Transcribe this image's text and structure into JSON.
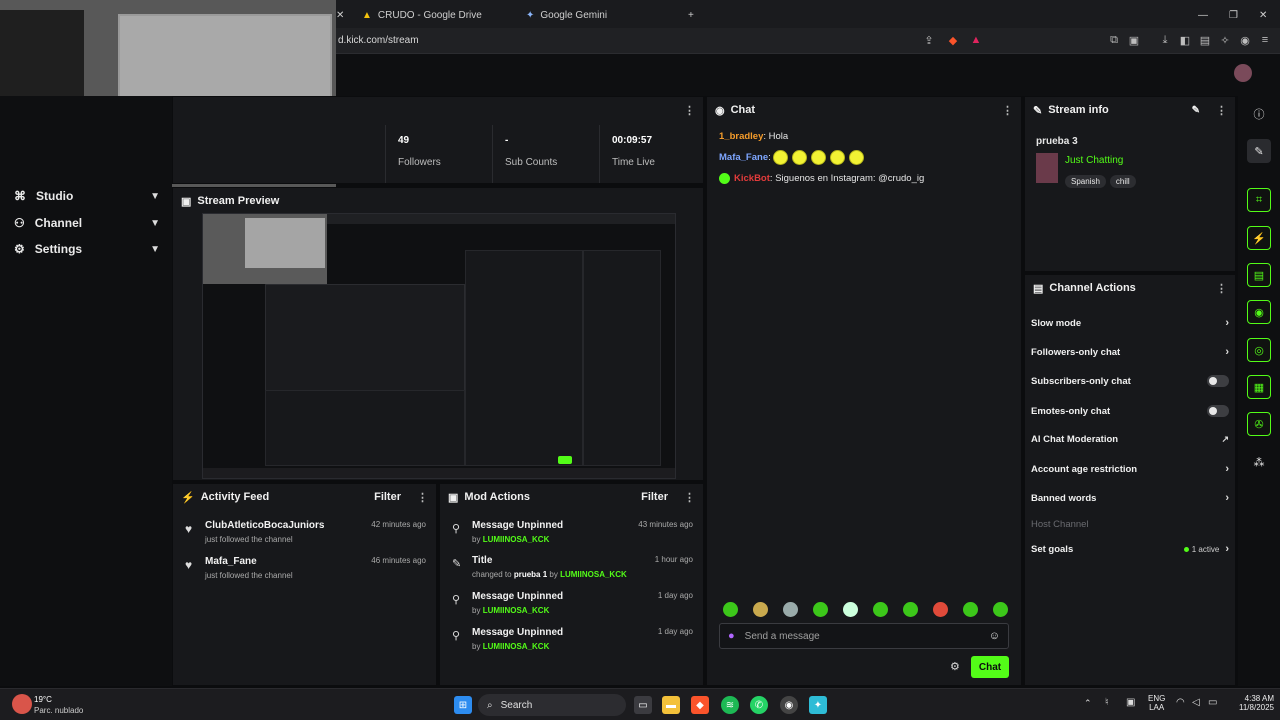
{
  "browser": {
    "tabs": [
      {
        "label": "CRUDO - Google Drive"
      },
      {
        "label": "Google Gemini"
      }
    ],
    "url": "d.kick.com/stream"
  },
  "sidebar": {
    "items": [
      {
        "label": "Studio"
      },
      {
        "label": "Channel"
      },
      {
        "label": "Settings"
      }
    ]
  },
  "stats": [
    {
      "value": "49",
      "label": "Followers"
    },
    {
      "value": "-",
      "label": "Sub Counts"
    },
    {
      "value": "00:09:57",
      "label": "Time Live"
    }
  ],
  "preview": {
    "title": "Stream Preview"
  },
  "activity": {
    "title": "Activity Feed",
    "filter": "Filter",
    "items": [
      {
        "name": "ClubAtleticoBocaJuniors",
        "sub": "just followed the channel",
        "time": "42 minutes ago"
      },
      {
        "name": "Mafa_Fane",
        "sub": "just followed the channel",
        "time": "46 minutes ago"
      }
    ]
  },
  "mod": {
    "title": "Mod Actions",
    "filter": "Filter",
    "items": [
      {
        "title": "Message Unpinned",
        "by": "by",
        "user": "LUMIINOSA_KCK",
        "mid": "",
        "time": "43 minutes ago"
      },
      {
        "title": "Title",
        "by": "changed to",
        "mid": "prueba 1",
        "by2": "by",
        "user": "LUMIINOSA_KCK",
        "time": "1 hour ago"
      },
      {
        "title": "Message Unpinned",
        "by": "by",
        "user": "LUMIINOSA_KCK",
        "mid": "",
        "time": "1 day ago"
      },
      {
        "title": "Message Unpinned",
        "by": "by",
        "user": "LUMIINOSA_KCK",
        "mid": "",
        "time": "1 day ago"
      }
    ]
  },
  "chat": {
    "title": "Chat",
    "messages": [
      {
        "user": "1_bradley",
        "color": "#f59c2b",
        "text": "Hola"
      },
      {
        "user": "Mafa_Fane",
        "color": "#7ea6ff",
        "text": ""
      },
      {
        "user": "KickBot",
        "color": "#e23b3b",
        "text": "Siguenos en Instagram: @crudo_ig"
      }
    ],
    "placeholder": "Send a message",
    "send": "Chat"
  },
  "stream_info": {
    "title": "Stream info",
    "stream_title": "prueba 3",
    "category": "Just Chatting",
    "tags": [
      "Spanish",
      "chill"
    ]
  },
  "channel_actions": {
    "title": "Channel Actions",
    "items": [
      {
        "label": "Slow mode",
        "control": "chevron"
      },
      {
        "label": "Followers-only chat",
        "control": "chevron"
      },
      {
        "label": "Subscribers-only chat",
        "control": "toggle"
      },
      {
        "label": "Emotes-only chat",
        "control": "toggle"
      },
      {
        "label": "AI Chat Moderation",
        "control": "external"
      },
      {
        "label": "Account age restriction",
        "control": "chevron"
      },
      {
        "label": "Banned words",
        "control": "chevron"
      },
      {
        "label": "Host Channel",
        "control": "none"
      },
      {
        "label": "Set goals",
        "control": "chevron",
        "extra": "1 active"
      }
    ]
  },
  "taskbar": {
    "weather_temp": "19°C",
    "weather_desc": "Parc. nublado",
    "search": "Search",
    "lang1": "ENG",
    "lang2": "LAA",
    "time": "4:38 AM",
    "date": "11/8/2025"
  },
  "colors": {
    "accent": "#53fc18",
    "panel": "#17181b",
    "background": "#0b0c0e"
  }
}
